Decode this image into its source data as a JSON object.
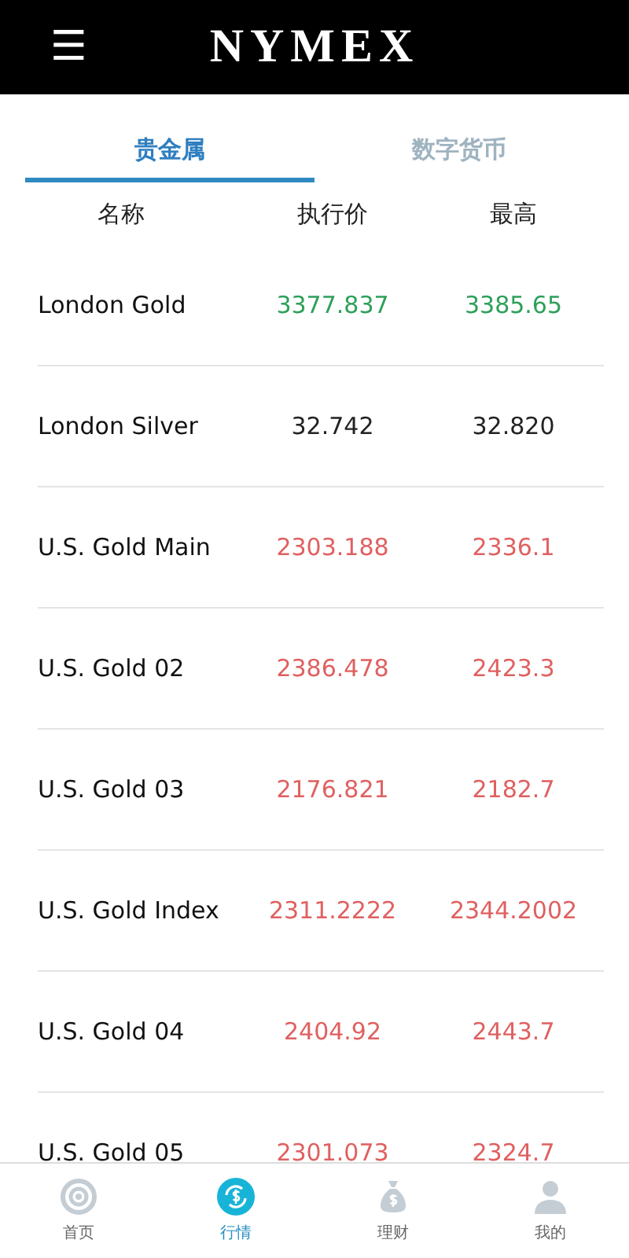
{
  "header": {
    "menu_icon": "☰",
    "logo": "NYMEX"
  },
  "tabs": [
    {
      "label": "贵金属",
      "selected": true
    },
    {
      "label": "数字货币",
      "selected": false
    }
  ],
  "columns": [
    "名称",
    "执行价",
    "最高"
  ],
  "rows": [
    {
      "name": "London Gold",
      "price": "3377.837",
      "high": "3385.65",
      "color": "#2ea05a"
    },
    {
      "name": "London Silver",
      "price": "32.742",
      "high": "32.820",
      "color": "#222222"
    },
    {
      "name": "U.S. Gold Main",
      "price": "2303.188",
      "high": "2336.1",
      "color": "#e06060"
    },
    {
      "name": "U.S. Gold 02",
      "price": "2386.478",
      "high": "2423.3",
      "color": "#e06060"
    },
    {
      "name": "U.S. Gold 03",
      "price": "2176.821",
      "high": "2182.7",
      "color": "#e06060"
    },
    {
      "name": "U.S. Gold Index",
      "price": "2311.2222",
      "high": "2344.2002",
      "color": "#e06060"
    },
    {
      "name": "U.S. Gold 04",
      "price": "2404.92",
      "high": "2443.7",
      "color": "#e06060"
    },
    {
      "name": "U.S. Gold 05",
      "price": "2301.073",
      "high": "2324.7",
      "color": "#e06060"
    }
  ],
  "nav": [
    {
      "kind": "home",
      "label": "首页",
      "selected": false
    },
    {
      "kind": "market",
      "label": "行情",
      "selected": true
    },
    {
      "kind": "finance",
      "label": "理财",
      "selected": false
    },
    {
      "kind": "profile",
      "label": "我的",
      "selected": false
    }
  ]
}
